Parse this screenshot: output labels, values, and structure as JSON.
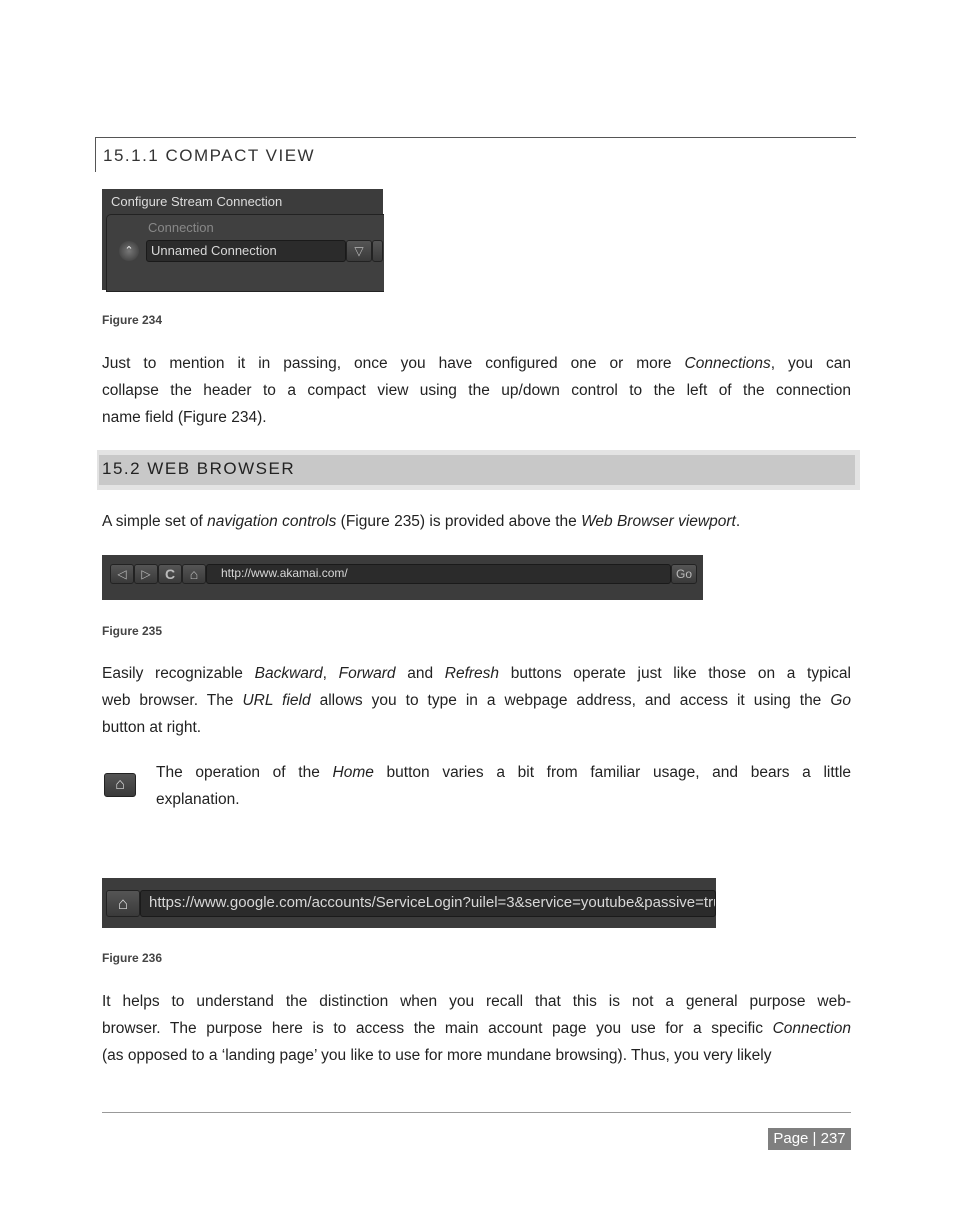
{
  "section_1511": {
    "title": "15.1.1  COMPACT VIEW"
  },
  "figure234": {
    "panel_title": "Configure Stream Connection",
    "connection_label": "Connection",
    "connection_value": "Unnamed Connection",
    "caption": "Figure 234"
  },
  "para1": [
    [
      [
        "Just to mention it in passing, once you have configured one or more ",
        false
      ],
      [
        "Connections",
        true
      ],
      [
        ", you can",
        false
      ]
    ],
    [
      [
        "collapse the header to a compact view using the up/down control to the left of the connection",
        false
      ]
    ],
    [
      [
        "name field (Figure 234).",
        false
      ]
    ]
  ],
  "section_152": {
    "title": "15.2  WEB BROWSER"
  },
  "para2": [
    [
      [
        "A simple set of ",
        false
      ],
      [
        "navigation controls",
        true
      ],
      [
        " (Figure 235) is provided above the ",
        false
      ],
      [
        "Web Browser viewport",
        true
      ],
      [
        ".",
        false
      ]
    ]
  ],
  "figure235": {
    "url": "http://www.akamai.com/",
    "go_label": "Go",
    "caption": "Figure 235"
  },
  "para3": [
    [
      [
        "Easily recognizable ",
        false
      ],
      [
        "Backward",
        true
      ],
      [
        ", ",
        false
      ],
      [
        "Forward",
        true
      ],
      [
        " and ",
        false
      ],
      [
        "Refresh",
        true
      ],
      [
        " buttons operate just like those on a typical",
        false
      ]
    ],
    [
      [
        "web browser. The ",
        false
      ],
      [
        "URL field",
        true
      ],
      [
        " allows you to type in a webpage address, and access it using the ",
        false
      ],
      [
        "Go",
        true
      ]
    ],
    [
      [
        "button at right.",
        false
      ]
    ]
  ],
  "para4": [
    [
      [
        " The operation of the ",
        false
      ],
      [
        "Home",
        true
      ],
      [
        " button varies a bit from familiar usage, and bears a little",
        false
      ]
    ],
    [
      [
        "explanation.",
        false
      ]
    ]
  ],
  "figure236": {
    "url": "https://www.google.com/accounts/ServiceLogin?uilel=3&service=youtube&passive=tru",
    "caption": "Figure 236"
  },
  "para5": [
    [
      [
        "It helps to understand the distinction when you recall that this is not a general purpose web-",
        false
      ]
    ],
    [
      [
        "browser. The purpose here is to access the main account page you use for a specific ",
        false
      ],
      [
        "Connection",
        true
      ]
    ],
    [
      [
        "(as opposed to a ‘landing page’ you like to use for more mundane browsing). Thus, you very likely",
        false
      ]
    ]
  ],
  "footer": {
    "page_label": "Page | 237"
  }
}
